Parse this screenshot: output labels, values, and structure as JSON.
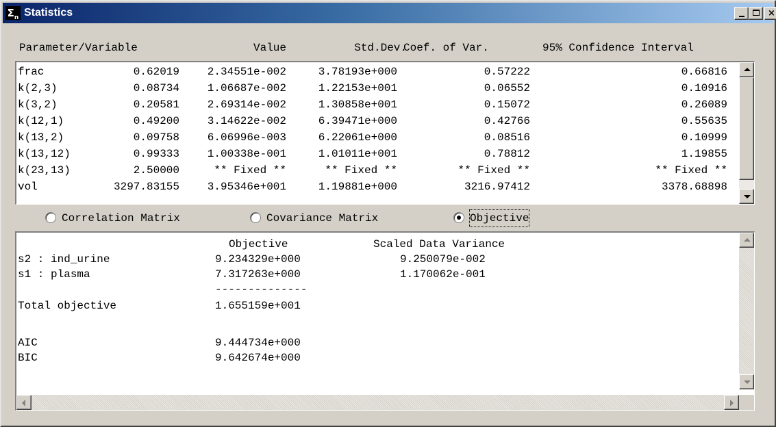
{
  "window": {
    "title": "Statistics",
    "icon_glyph": "Σ",
    "icon_sub": "n",
    "buttons": {
      "minimize": "minimize-icon",
      "maximize": "maximize-icon",
      "close": "×"
    }
  },
  "params_table": {
    "headers": {
      "name": "Parameter/Variable",
      "value": "Value",
      "sd": "Std.Dev.",
      "cv": "Coef. of Var.",
      "ci": "95% Confidence Interval"
    },
    "rows": [
      {
        "name": "frac",
        "value": "0.62019",
        "sd": "2.34551e-002",
        "cv": "3.78193e+000",
        "lo": "0.57222",
        "hi": "0.66816"
      },
      {
        "name": "k(2,3)",
        "value": "0.08734",
        "sd": "1.06687e-002",
        "cv": "1.22153e+001",
        "lo": "0.06552",
        "hi": "0.10916"
      },
      {
        "name": "k(3,2)",
        "value": "0.20581",
        "sd": "2.69314e-002",
        "cv": "1.30858e+001",
        "lo": "0.15072",
        "hi": "0.26089"
      },
      {
        "name": "k(12,1)",
        "value": "0.49200",
        "sd": "3.14622e-002",
        "cv": "6.39471e+000",
        "lo": "0.42766",
        "hi": "0.55635"
      },
      {
        "name": "k(13,2)",
        "value": "0.09758",
        "sd": "6.06996e-003",
        "cv": "6.22061e+000",
        "lo": "0.08516",
        "hi": "0.10999"
      },
      {
        "name": "k(13,12)",
        "value": "0.99333",
        "sd": "1.00338e-001",
        "cv": "1.01011e+001",
        "lo": "0.78812",
        "hi": "1.19855"
      },
      {
        "name": "k(23,13)",
        "value": "2.50000",
        "sd": "** Fixed **",
        "cv": "** Fixed **",
        "lo": "** Fixed **",
        "hi": "** Fixed **"
      },
      {
        "name": "vol",
        "value": "3297.83155",
        "sd": "3.95346e+001",
        "cv": "1.19881e+000",
        "lo": "3216.97412",
        "hi": "3378.68898"
      }
    ]
  },
  "view_options": {
    "correlation": "Correlation Matrix",
    "covariance": "Covariance Matrix",
    "objective": "Objective",
    "selected": "objective"
  },
  "objective_panel": {
    "col_objective": "Objective",
    "col_scaled": "Scaled Data Variance",
    "rows": [
      {
        "label": "s2 : ind_urine",
        "objective": "9.234329e+000",
        "scaled": "9.250079e-002"
      },
      {
        "label": "s1 : plasma",
        "objective": "7.317263e+000",
        "scaled": "1.170062e-001"
      }
    ],
    "separator": "--------------",
    "total_label": "Total objective",
    "total_value": "1.655159e+001",
    "aic_label": "AIC",
    "aic_value": "9.444734e+000",
    "bic_label": "BIC",
    "bic_value": "9.642674e+000"
  }
}
